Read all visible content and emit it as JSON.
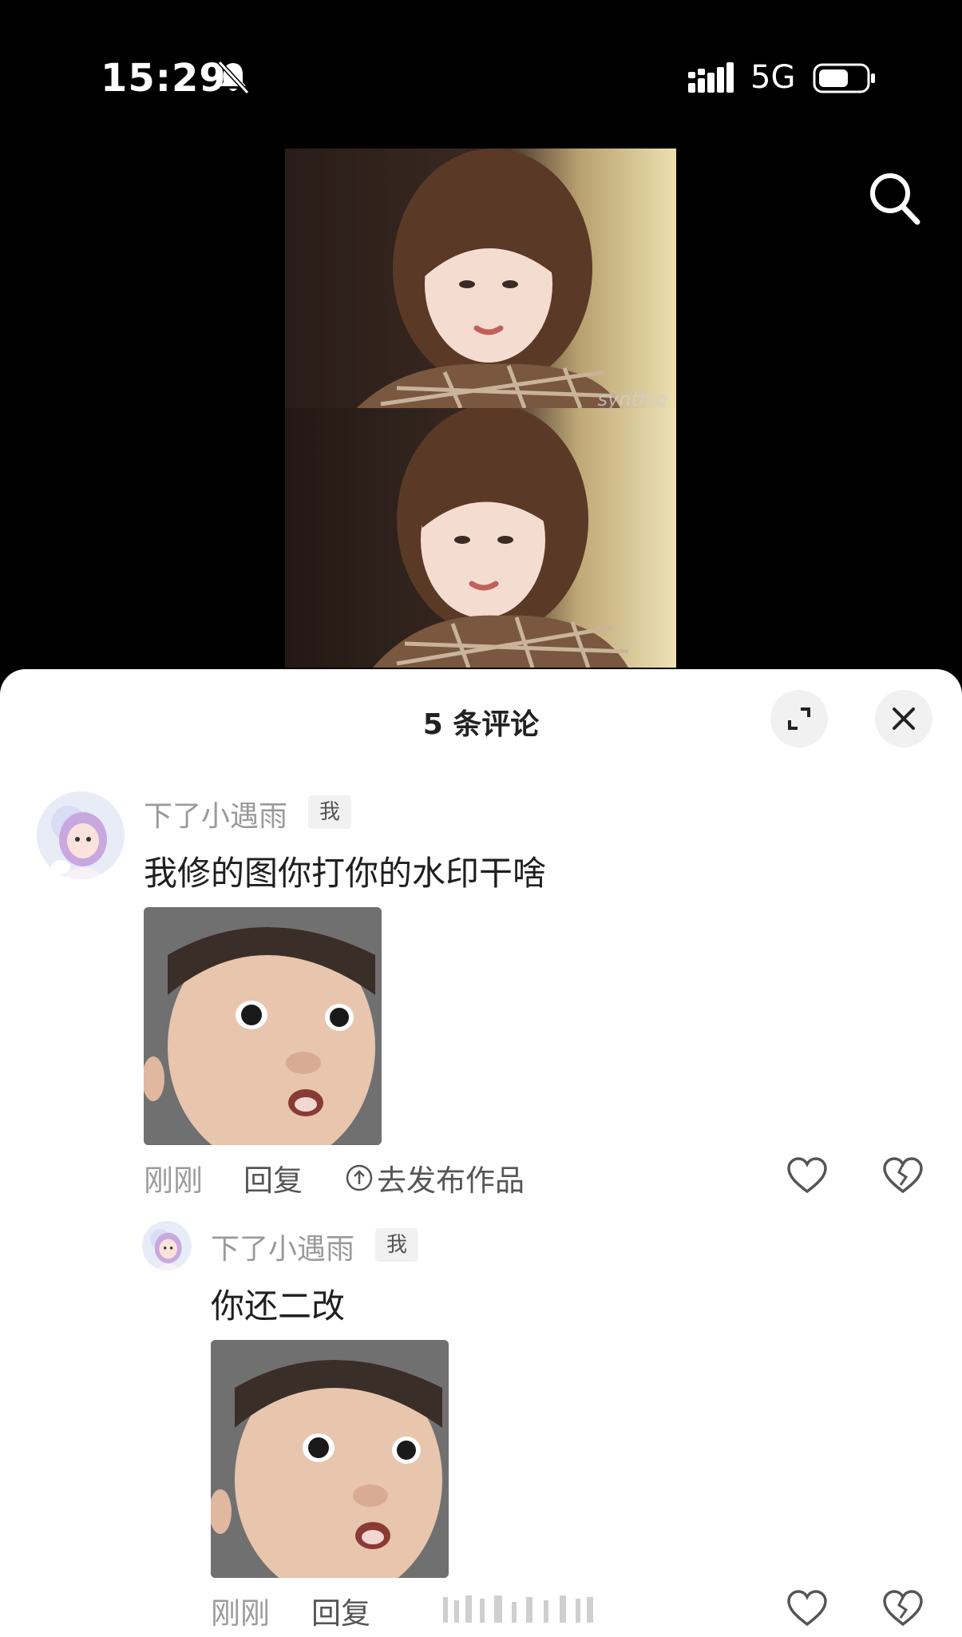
{
  "status_bar": {
    "time": "15:29",
    "network": "5G"
  },
  "photo": {
    "watermark": "synthig"
  },
  "comments_panel": {
    "title": "5 条评论",
    "comments": [
      {
        "author": "下了小遇雨",
        "badge": "我",
        "text": "我修的图你打你的水印干啥",
        "time": "刚刚",
        "reply_label": "回复",
        "publish_label": "去发布作品"
      },
      {
        "author": "下了小遇雨",
        "badge": "我",
        "text": "你还二改",
        "time": "刚刚",
        "reply_label": "回复"
      }
    ]
  },
  "colors": {
    "background": "#000000",
    "sheet": "#ffffff",
    "muted_text": "#9a9a9a"
  }
}
